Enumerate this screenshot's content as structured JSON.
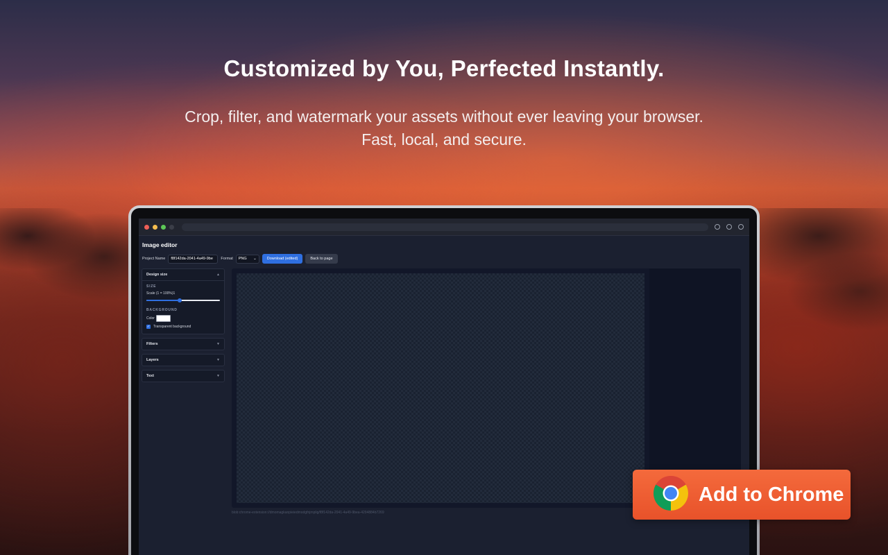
{
  "hero": {
    "headline": "Customized by You, Perfected Instantly.",
    "subline_1": "Crop, filter, and watermark your assets without ever leaving your browser.",
    "subline_2": "Fast, local, and secure."
  },
  "editor": {
    "title": "Image editor",
    "toolbar": {
      "project_name_label": "Project Name",
      "project_name_value": "f8f142da-2041-4a49-9be",
      "format_label": "Format",
      "format_value": "PNG",
      "download_label": "Download (edited)",
      "back_label": "Back to page"
    },
    "panels": {
      "design_size": {
        "title": "Design size",
        "size_section": "SIZE",
        "scale_label": "Scale (1 = 100%)1",
        "scale_value": 0.45,
        "background_section": "BACKGROUND",
        "color_label": "Color",
        "transparent_label": "Transparent background",
        "transparent_checked": true
      },
      "filters": {
        "title": "Filters"
      },
      "layers": {
        "title": "Layers"
      },
      "text": {
        "title": "Text"
      }
    },
    "blob_url": "blob:chrome-extension://dmomagkanpieiedmodgfnjmplig/f8f142da-2041-4a49-9bea-4294884b7269"
  },
  "cta": {
    "label": "Add to Chrome"
  },
  "colors": {
    "accent_blue": "#2f6fe0",
    "cta_orange": "#e8522a"
  },
  "icons": [
    "chrome-logo-icon",
    "chevron-up-icon",
    "chevron-down-icon",
    "checkbox-checked-icon"
  ]
}
